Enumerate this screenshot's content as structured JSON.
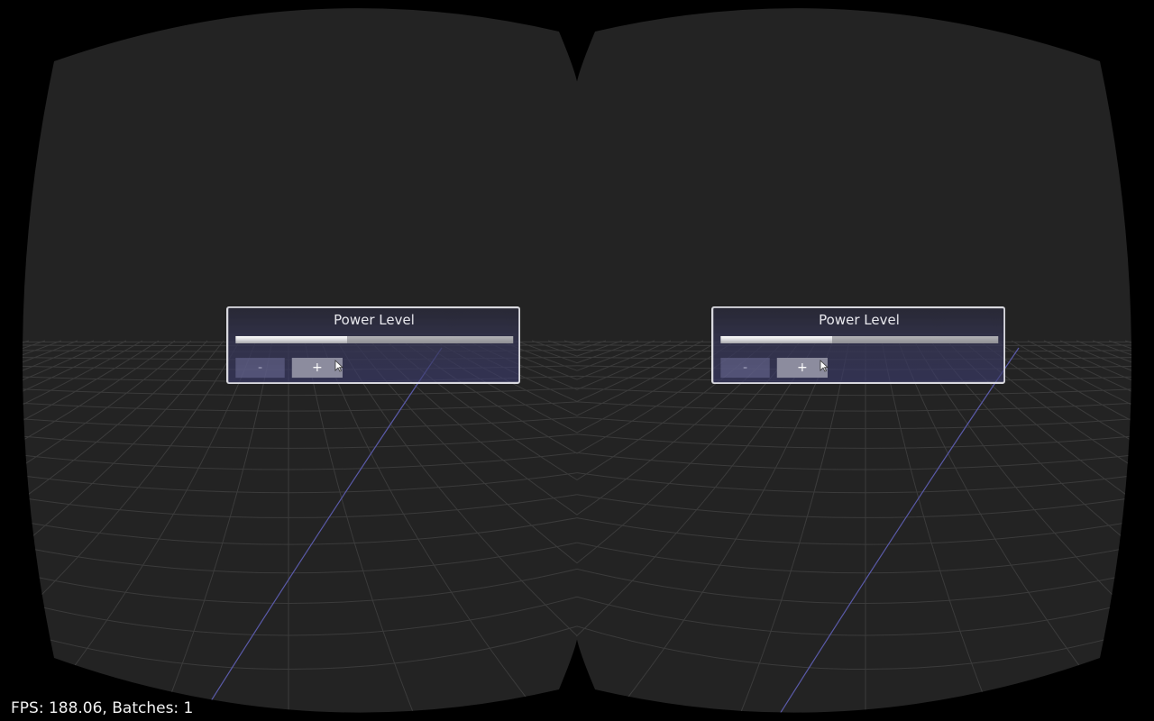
{
  "scene": {
    "background_color": "#000000",
    "viewport_color": "#232323",
    "grid_color": "#3b3b3b",
    "axis_line_color": "#5a5aa8",
    "views": [
      {
        "eye": "left",
        "panel": {
          "title": "Power Level",
          "progress": 0.4,
          "minus_label": "-",
          "plus_label": "+",
          "cursor_icon": "mouse-cursor-icon"
        }
      },
      {
        "eye": "right",
        "panel": {
          "title": "Power Level",
          "progress": 0.4,
          "minus_label": "-",
          "plus_label": "+",
          "cursor_icon": "mouse-cursor-icon"
        }
      }
    ]
  },
  "overlay": {
    "fps_text": "FPS: 188.06, Batches: 1"
  }
}
